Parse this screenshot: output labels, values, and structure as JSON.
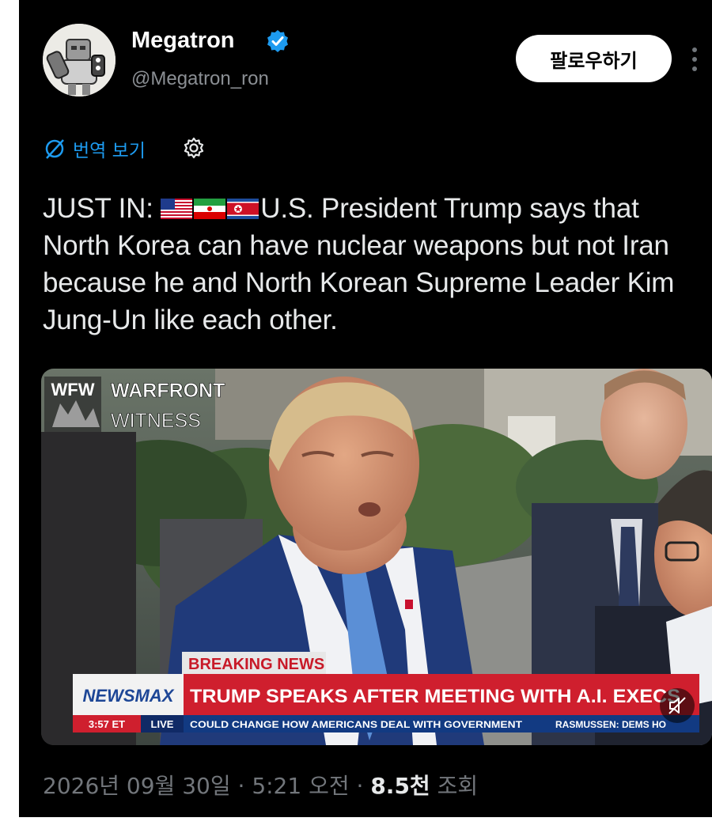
{
  "user": {
    "name": "Megatron",
    "handle": "@Megatron_ron",
    "follow_label": "팔로우하기"
  },
  "translate": {
    "label": "번역 보기"
  },
  "tweet": {
    "prefix": "JUST IN: ",
    "flags": [
      "us-flag",
      "iran-flag",
      "north-korea-flag"
    ],
    "body": "U.S. President Trump says that North Korea can have nuclear weapons but not Iran because he and North Korean Supreme Leader Kim Jung-Un like each other."
  },
  "media": {
    "watermark_line1": "WARFRONT",
    "watermark_line2": "WITNESS",
    "watermark_logo": "WFW",
    "breaking_label": "BREAKING NEWS",
    "network": "NEWSMAX",
    "headline": "TRUMP SPEAKS AFTER MEETING WITH A.I. EXECS",
    "time": "3:57 ET",
    "live": "LIVE",
    "ticker": "COULD CHANGE HOW AMERICANS DEAL WITH GOVERNMENT",
    "ticker_right": "RASMUSSEN: DEMS HO",
    "mute_icon": "muted-speaker-icon"
  },
  "footer": {
    "date": "2026년 09월 30일",
    "sep1": " · ",
    "time": "5:21 오전",
    "sep2": " · ",
    "views_count": "8.5천",
    "views_label": " 조회"
  },
  "colors": {
    "background": "#000000",
    "accent": "#1d9bf0",
    "newsmax_red": "#cf1f2e",
    "ticker_blue": "#123a82"
  }
}
